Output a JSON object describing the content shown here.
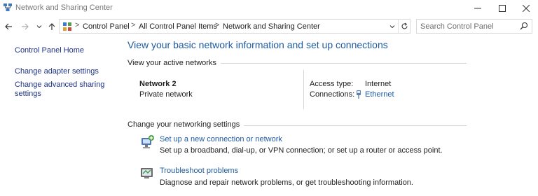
{
  "window": {
    "title": "Network and Sharing Center"
  },
  "address_bar": {
    "breadcrumbs": [
      "Control Panel",
      "All Control Panel Items",
      "Network and Sharing Center"
    ],
    "separator": ">"
  },
  "search": {
    "placeholder": "Search Control Panel"
  },
  "left_pane": {
    "links": [
      "Control Panel Home",
      "Change adapter settings",
      "Change advanced sharing settings"
    ]
  },
  "main": {
    "title": "View your basic network information and set up connections",
    "active_networks": {
      "header": "View your active networks",
      "network_name": "Network 2",
      "network_type": "Private network",
      "access_type_label": "Access type:",
      "access_type_value": "Internet",
      "connections_label": "Connections:",
      "connections_value": "Ethernet"
    },
    "networking_settings": {
      "header": "Change your networking settings",
      "tasks": [
        {
          "link": "Set up a new connection or network",
          "description": "Set up a broadband, dial-up, or VPN connection; or set up a router or access point."
        },
        {
          "link": "Troubleshoot problems",
          "description": "Diagnose and repair network problems, or get troubleshooting information."
        }
      ]
    }
  },
  "colors": {
    "link": "#1e5aa0",
    "left_link": "#1e3287",
    "title": "#1e5aa0",
    "divider": "#d6d6d6"
  },
  "icons": {
    "app": "network-sharing-icon",
    "back": "back-arrow-icon",
    "forward": "forward-arrow-icon",
    "recent": "chevron-down-icon",
    "up": "up-arrow-icon",
    "address": "control-panel-icon",
    "dropdown": "chevron-down-icon",
    "refresh": "refresh-icon",
    "search": "search-icon",
    "ethernet": "ethernet-icon",
    "new_connection": "new-connection-icon",
    "troubleshoot": "troubleshoot-icon"
  }
}
